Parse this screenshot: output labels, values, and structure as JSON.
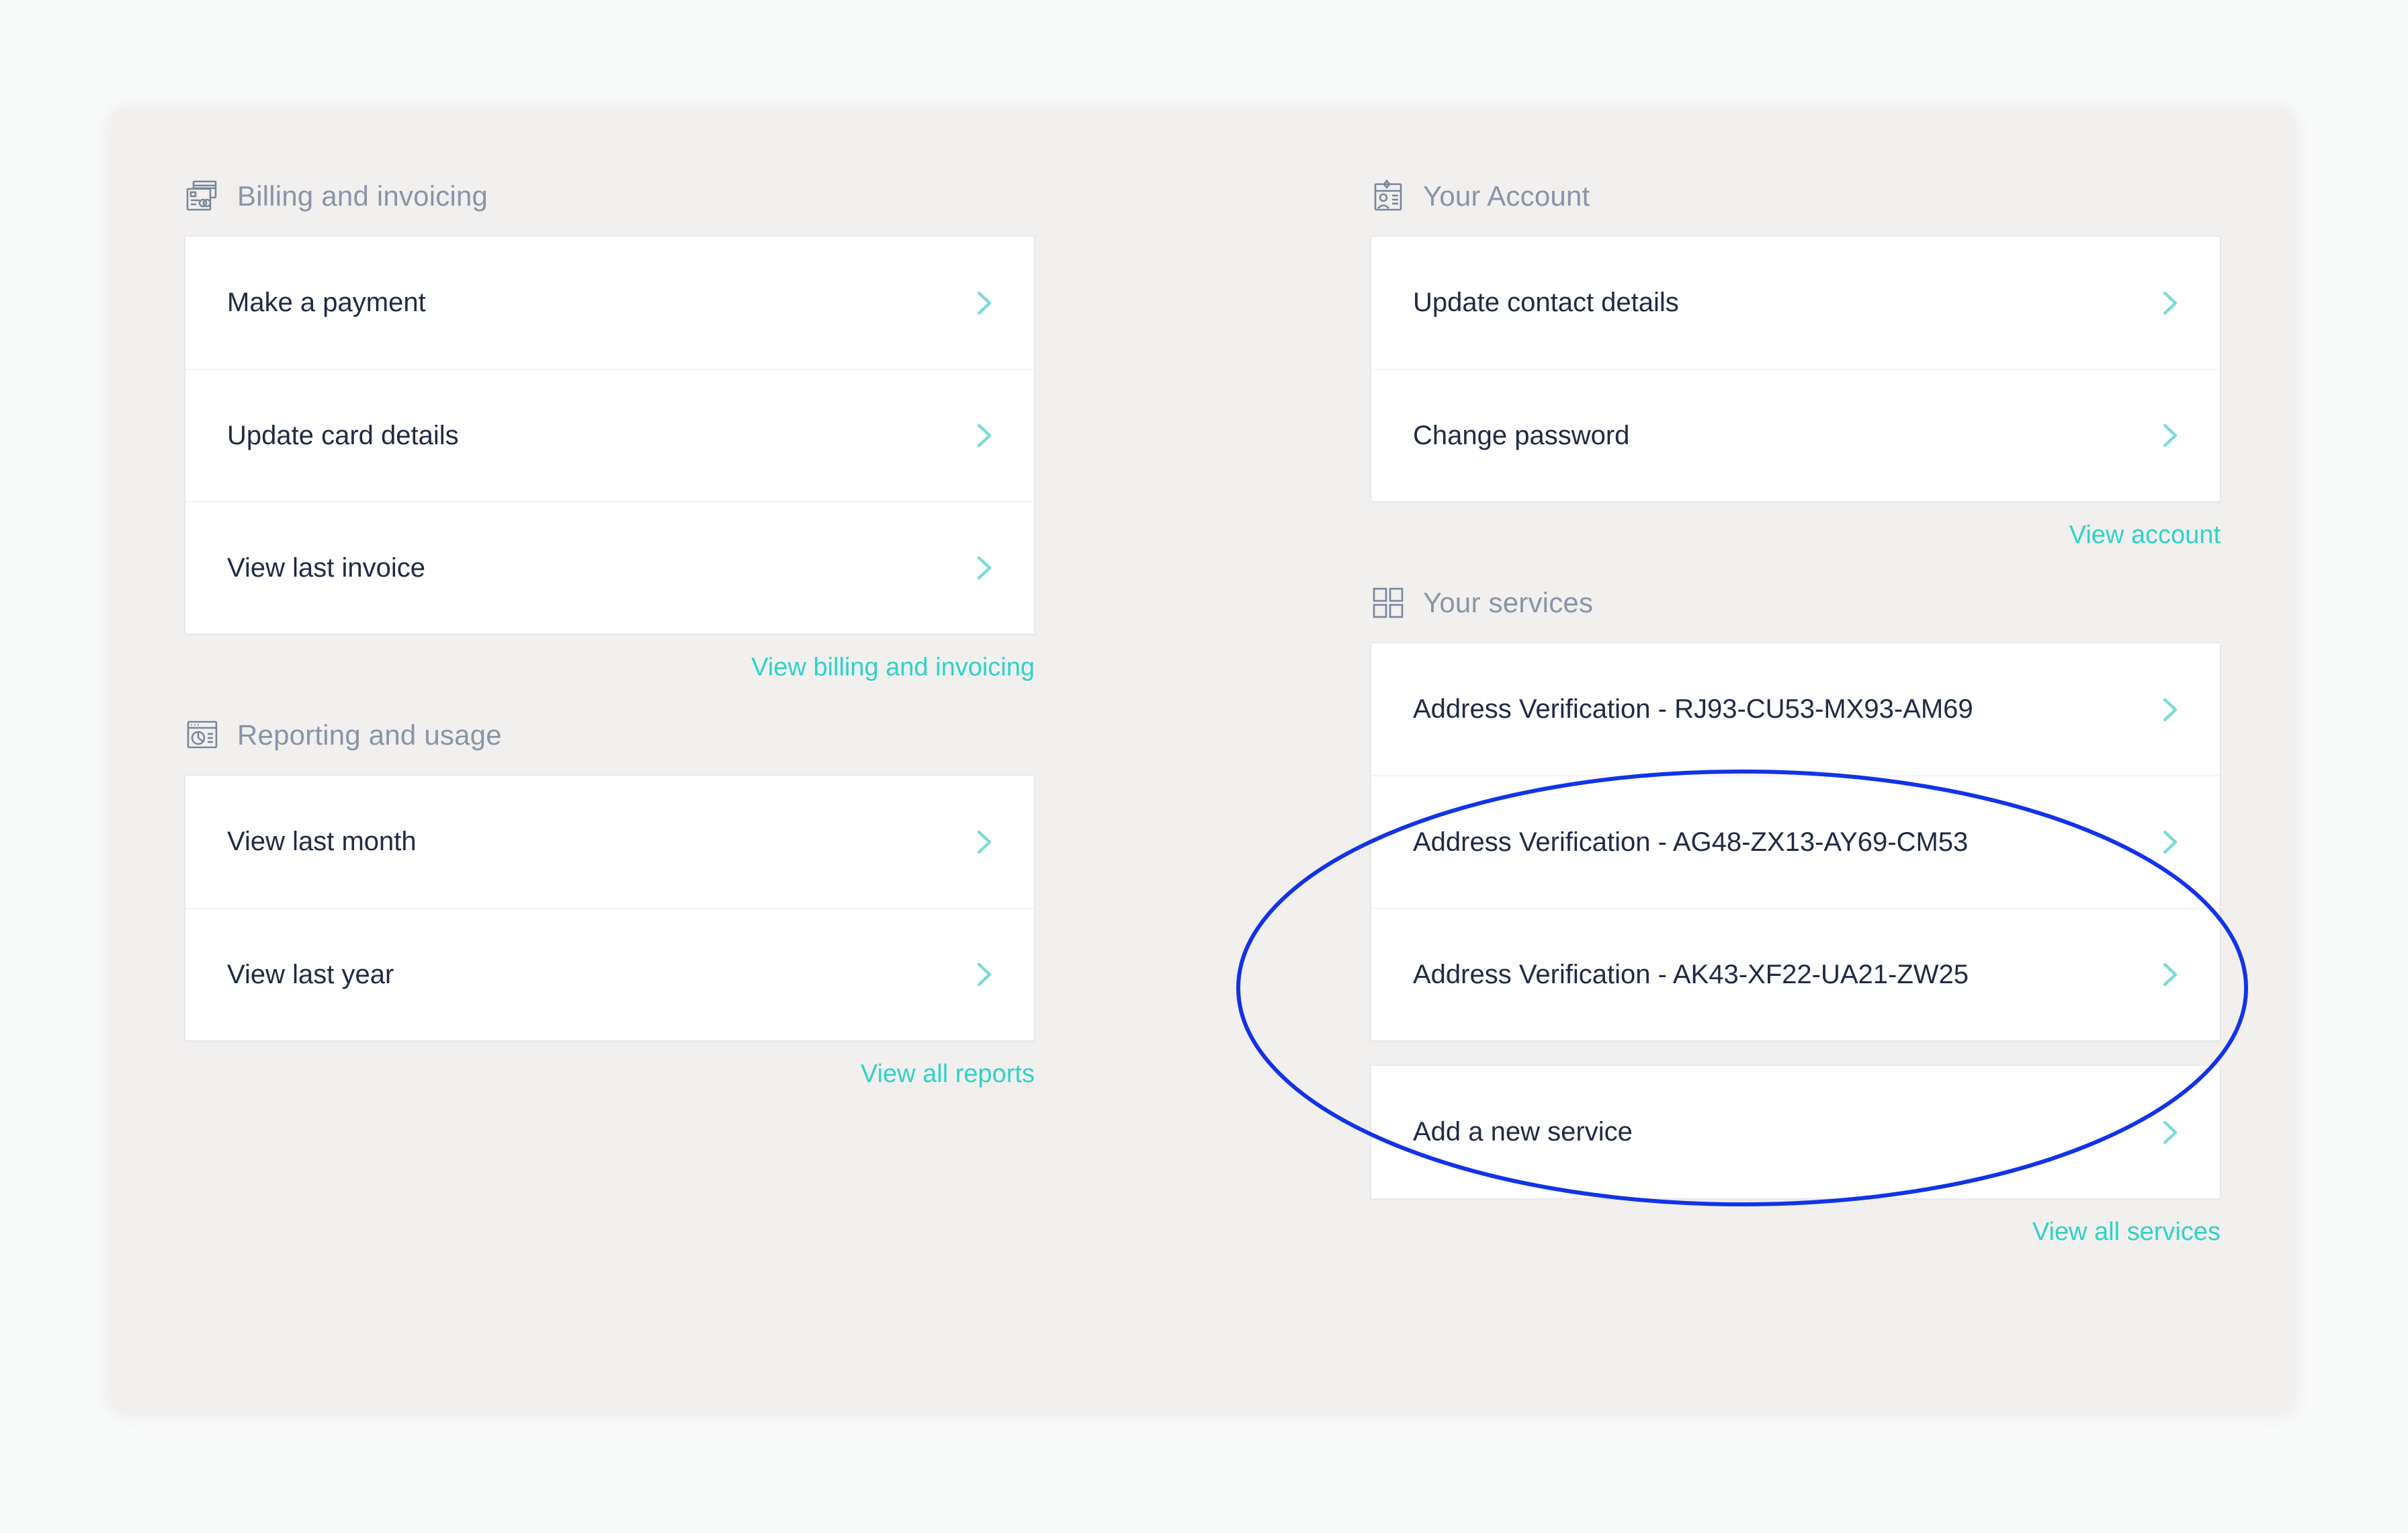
{
  "panel": {
    "accent_link_color": "#2ed3c6",
    "chevron_color": "#7adbd8",
    "row_text_color": "#1f2a44",
    "section_title_color": "#8a94a6",
    "panel_background": "#f1f0ef",
    "page_background": "#f8f9f9"
  },
  "annotation": {
    "shape": "ellipse",
    "color": "#1233e8",
    "stroke_width": 6,
    "target": "your-services-list"
  },
  "sections": {
    "billing": {
      "title": "Billing and invoicing",
      "icon": "invoice-card-icon",
      "rows": [
        {
          "label": "Make a payment",
          "icon": "chevron-right-icon"
        },
        {
          "label": "Update card details",
          "icon": "chevron-right-icon"
        },
        {
          "label": "View last invoice",
          "icon": "chevron-right-icon"
        }
      ],
      "link": "View billing and invoicing"
    },
    "reporting": {
      "title": "Reporting and usage",
      "icon": "report-window-icon",
      "rows": [
        {
          "label": "View last month",
          "icon": "chevron-right-icon"
        },
        {
          "label": "View last year",
          "icon": "chevron-right-icon"
        }
      ],
      "link": "View all reports"
    },
    "account": {
      "title": "Your Account",
      "icon": "id-badge-icon",
      "rows": [
        {
          "label": "Update contact details",
          "icon": "chevron-right-icon"
        },
        {
          "label": "Change password",
          "icon": "chevron-right-icon"
        }
      ],
      "link": "View account"
    },
    "services": {
      "title": "Your services",
      "icon": "grid-squares-icon",
      "rows": [
        {
          "label": "Address Verification - RJ93-CU53-MX93-AM69",
          "icon": "chevron-right-icon"
        },
        {
          "label": "Address Verification - AG48-ZX13-AY69-CM53",
          "icon": "chevron-right-icon"
        },
        {
          "label": "Address Verification - AK43-XF22-UA21-ZW25",
          "icon": "chevron-right-icon"
        }
      ],
      "add_row": {
        "label": "Add a new service",
        "icon": "chevron-right-icon"
      },
      "link": "View all services"
    }
  }
}
